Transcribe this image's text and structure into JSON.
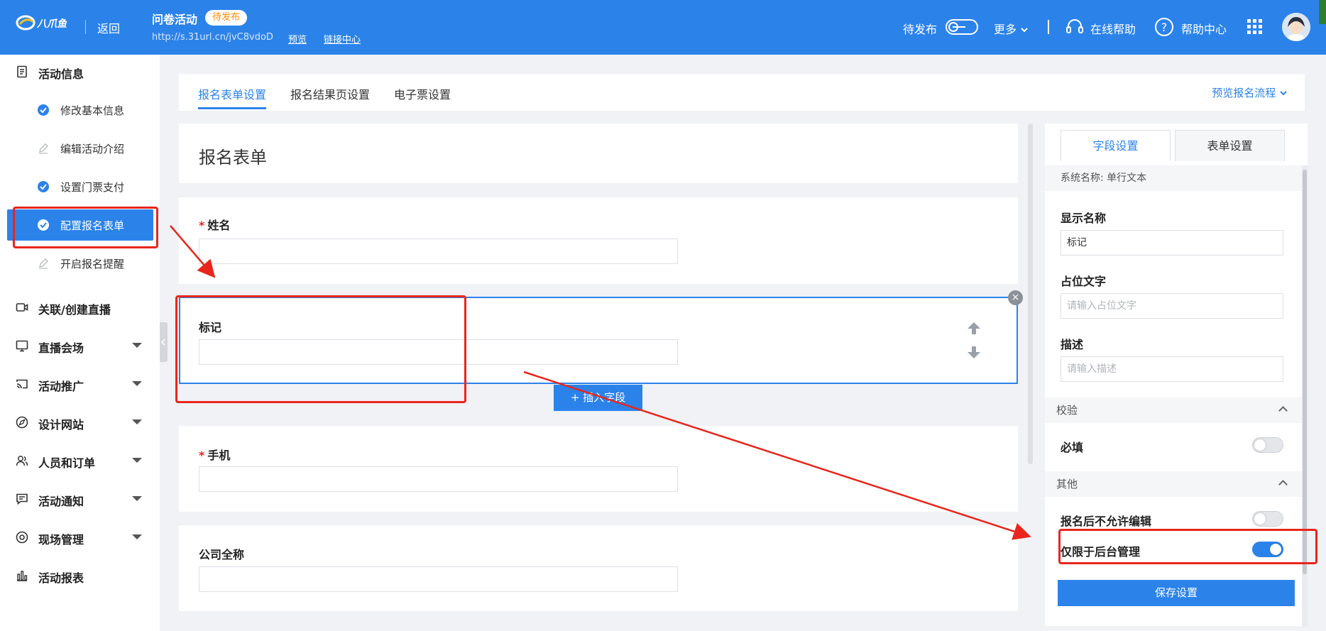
{
  "header": {
    "back": "返回",
    "title": "问卷活动",
    "status": "待发布",
    "url": "http://s.31url.cn/jvC8vdoD",
    "preview": "预览",
    "link_center": "链接中心",
    "publish_label": "待发布",
    "more": "更多",
    "online_help": "在线帮助",
    "help_center": "帮助中心"
  },
  "sidebar": {
    "activity_info": "活动信息",
    "sub_items": [
      {
        "label": "修改基本信息",
        "state": "done"
      },
      {
        "label": "编辑活动介绍",
        "state": "pending"
      },
      {
        "label": "设置门票支付",
        "state": "done"
      },
      {
        "label": "配置报名表单",
        "state": "active"
      },
      {
        "label": "开启报名提醒",
        "state": "pending"
      }
    ],
    "items": [
      {
        "label": "关联/创建直播",
        "icon": "video-icon"
      },
      {
        "label": "直播会场",
        "icon": "monitor-icon"
      },
      {
        "label": "活动推广",
        "icon": "cast-icon"
      },
      {
        "label": "设计网站",
        "icon": "compass-icon"
      },
      {
        "label": "人员和订单",
        "icon": "users-icon"
      },
      {
        "label": "活动通知",
        "icon": "message-icon"
      },
      {
        "label": "现场管理",
        "icon": "target-icon"
      },
      {
        "label": "活动报表",
        "icon": "bar-chart-icon"
      }
    ]
  },
  "tabs": {
    "items": [
      "报名表单设置",
      "报名结果页设置",
      "电子票设置"
    ],
    "preview_flow": "预览报名流程"
  },
  "form": {
    "title": "报名表单",
    "fields": [
      {
        "label": "姓名",
        "required": true
      },
      {
        "label": "标记",
        "required": false
      },
      {
        "label": "手机",
        "required": true
      },
      {
        "label": "公司全称",
        "required": false
      }
    ],
    "insert_button": "插入字段"
  },
  "panel": {
    "tabs": [
      "字段设置",
      "表单设置"
    ],
    "system_name": "系统名称: 单行文本",
    "display_name_label": "显示名称",
    "display_name_value": "标记",
    "placeholder_label": "占位文字",
    "placeholder_ph": "请输入占位文字",
    "desc_label": "描述",
    "desc_ph": "请输入描述",
    "section_validate": "校验",
    "required_label": "必填",
    "required_on": false,
    "section_other": "其他",
    "no_edit_label": "报名后不允许编辑",
    "no_edit_on": false,
    "admin_only_label": "仅限于后台管理",
    "admin_only_on": true,
    "save": "保存设置"
  },
  "colors": {
    "primary": "#2b83ea",
    "annotation": "#e8261d",
    "status_tag": "#ff8a00"
  }
}
